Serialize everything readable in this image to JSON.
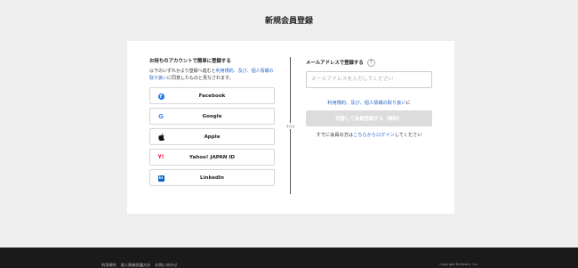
{
  "page_title": "新規会員登録",
  "social": {
    "heading": "お持ちのアカウントで簡単に登録する",
    "desc_before": "以下のいずれかより登録へ進むと",
    "desc_link": "利用規約、及び、個人情報の取り扱い",
    "desc_after": "に同意したものと見なされます。",
    "buttons": [
      {
        "label": "Facebook",
        "icon": "facebook-icon"
      },
      {
        "label": "Google",
        "icon": "google-icon"
      },
      {
        "label": "Apple",
        "icon": "apple-icon"
      },
      {
        "label": "Yahoo! JAPAN ID",
        "icon": "yahoo-japan-icon"
      },
      {
        "label": "LinkedIn",
        "icon": "linkedin-icon"
      }
    ]
  },
  "divider_label": "または",
  "email": {
    "heading": "メールアドレスで登録する",
    "help": "?",
    "placeholder": "メールアドレスを入力してください",
    "terms_link": "利用規約、及び、個人情報の取り扱い",
    "terms_suffix": "に",
    "submit_label": "同意して会員登録する（無料）",
    "login_prefix": "すでに会員の方は",
    "login_link": "こちらからログイン",
    "login_suffix": "してください"
  },
  "footer": {
    "links": [
      "利用規約",
      "個人情報保護方針",
      "お問い合わせ"
    ],
    "copyright": "Copyright BizReach, Inc."
  },
  "colors": {
    "background": "#eeeeee",
    "link": "#2266cc",
    "footer": "#1a1a1a",
    "facebook": "#1877f2",
    "yahoo": "#ff0033",
    "linkedin": "#0a66c2"
  }
}
